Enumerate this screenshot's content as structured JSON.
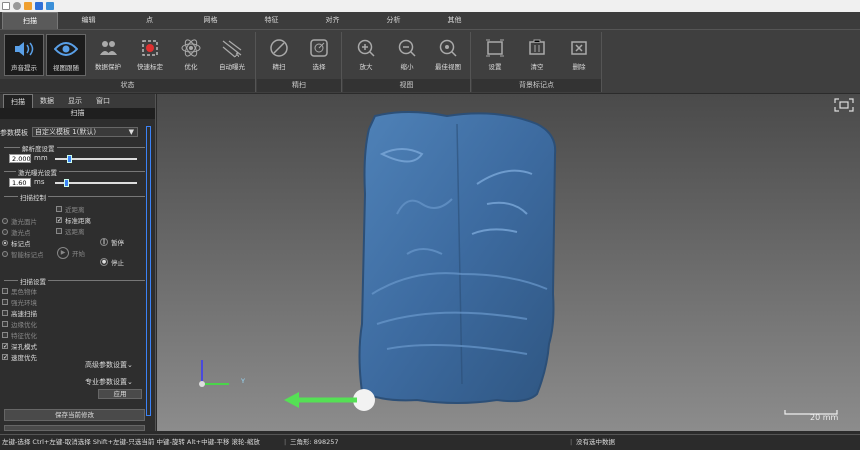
{
  "menu": [
    "扫描",
    "编辑",
    "点",
    "网格",
    "特征",
    "对齐",
    "分析",
    "其他"
  ],
  "ribbon": {
    "groups": [
      {
        "title": "状态",
        "buttons": [
          "声音提示",
          "视图跟随",
          "数据保护",
          "快速标定",
          "优化",
          "自动曝光"
        ]
      },
      {
        "title": "精扫",
        "buttons": [
          "精扫",
          "选择"
        ]
      },
      {
        "title": "视图",
        "buttons": [
          "放大",
          "缩小",
          "最佳视图"
        ]
      },
      {
        "title": "背景标记点",
        "buttons": [
          "设置",
          "清空",
          "删除"
        ]
      }
    ]
  },
  "panel": {
    "tabs": [
      "扫描",
      "数据",
      "显示",
      "窗口"
    ],
    "header": "扫描",
    "param_label": "参数模板",
    "param_value": "自定义模板 1(默认)",
    "resolution_section": "解析度设置",
    "resolution_value": "2.000",
    "resolution_unit": "mm",
    "exposure_section": "激光曝光设置",
    "exposure_value": "1.60",
    "exposure_unit": "ms",
    "scan_control_section": "扫描控制",
    "distance": [
      "近距离",
      "标准距离",
      "远距离"
    ],
    "modes": [
      "激光面片",
      "激光点",
      "标记点",
      "智能标记点"
    ],
    "start": "开始",
    "pause": "暂停",
    "stop": "停止",
    "scan_settings_section": "扫描设置",
    "settings": [
      {
        "label": "黑色物体",
        "checked": false
      },
      {
        "label": "强光环境",
        "checked": false
      },
      {
        "label": "高速扫描",
        "checked": false
      },
      {
        "label": "边缘优化",
        "checked": false
      },
      {
        "label": "特征优化",
        "checked": false
      },
      {
        "label": "深孔模式",
        "checked": true
      },
      {
        "label": "速度优先",
        "checked": true
      }
    ],
    "advanced": "高级参数设置",
    "pro": "专业参数设置",
    "apply": "应用",
    "save": "保存当前修改"
  },
  "viewport": {
    "scale": "20 mm",
    "axis_y": "Y"
  },
  "status": {
    "hint": "左键-选择 Ctrl+左键-取消选择 Shift+左键-只选当前 中键-旋转 Alt+中键-平移 滚轮-缩放",
    "triangles": "三角形: 898257",
    "selection": "没有选中数据"
  },
  "colors": {
    "accent": "#3b82f6",
    "model": "#3e6ea3"
  }
}
